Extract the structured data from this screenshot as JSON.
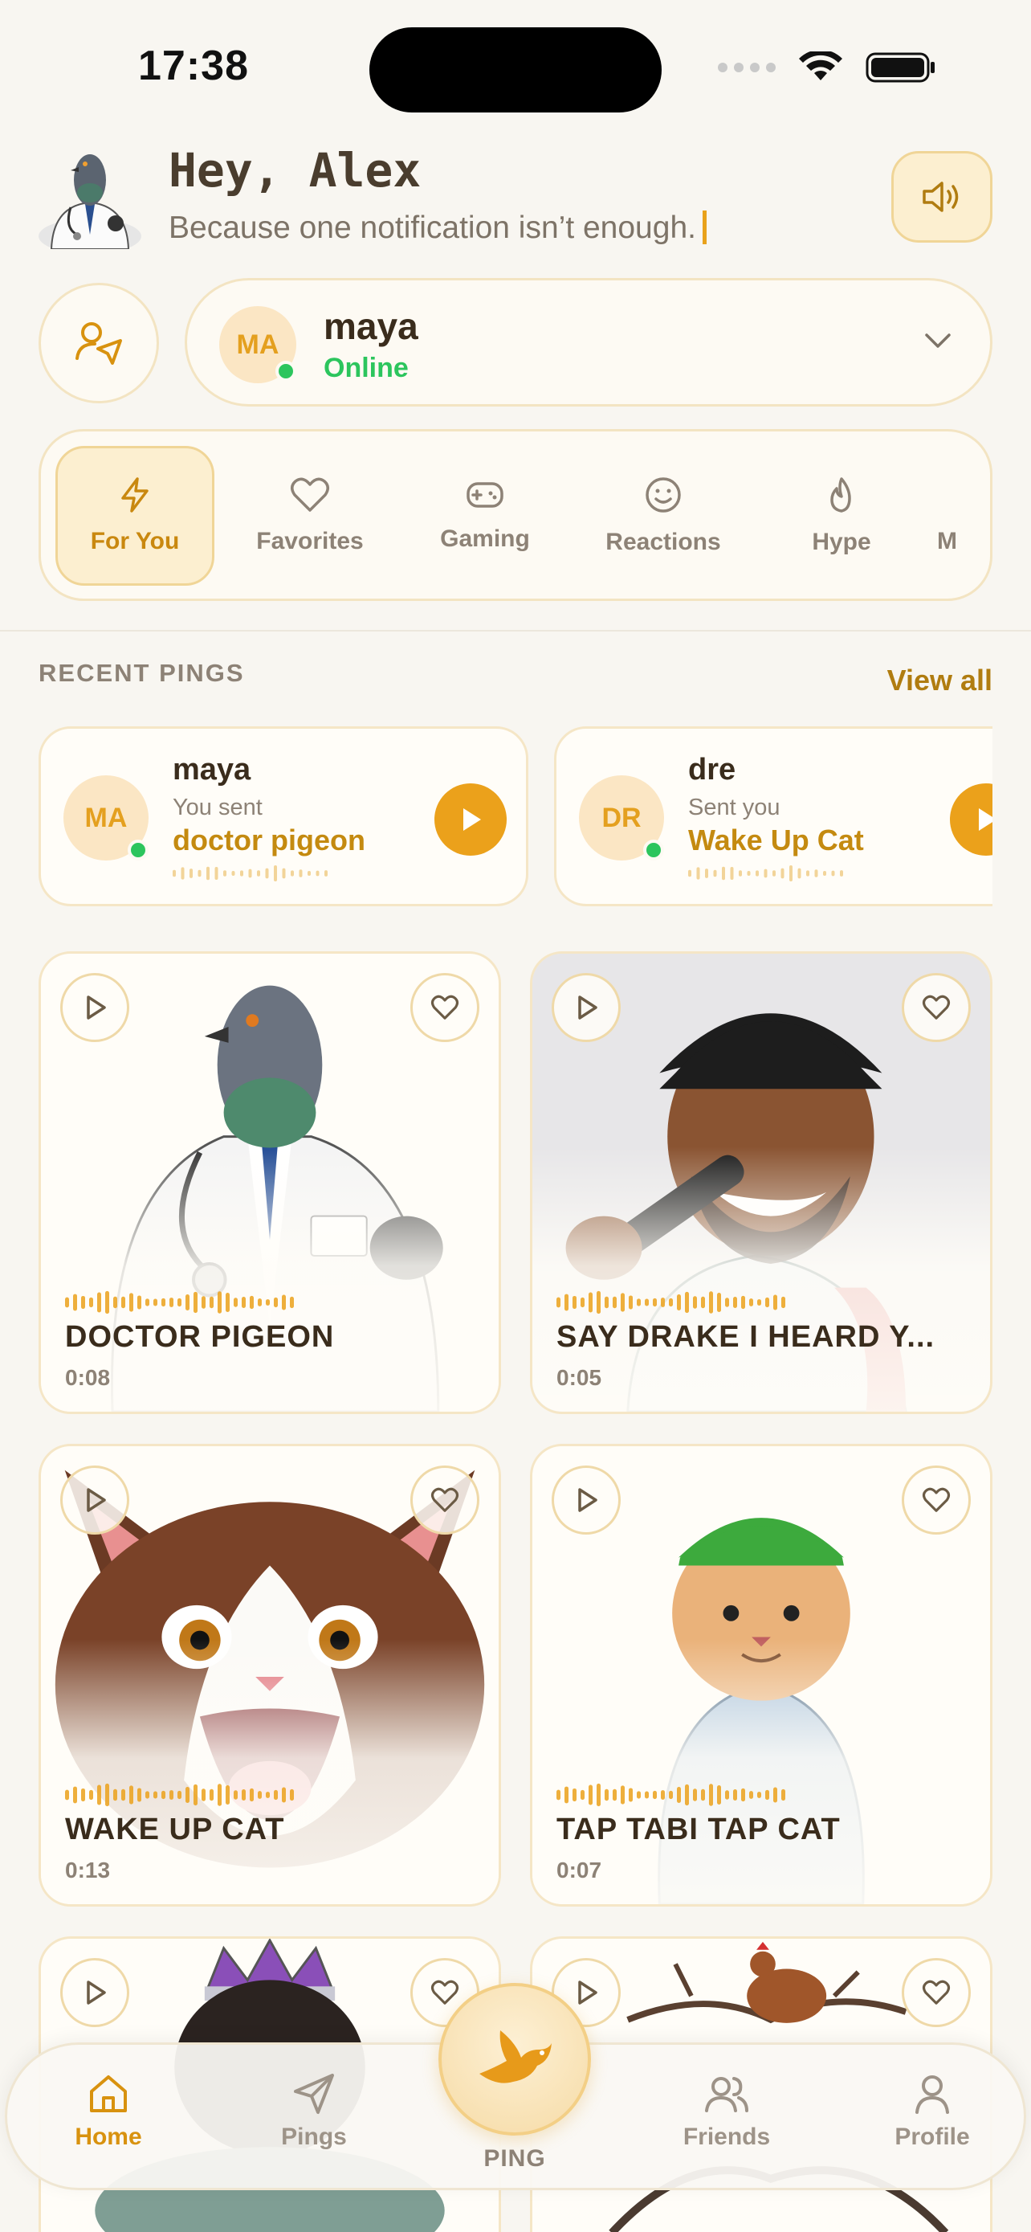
{
  "status_bar": {
    "time": "17:38"
  },
  "header": {
    "greeting": "Hey, Alex",
    "tagline": "Because one notification isn’t enough."
  },
  "recipient": {
    "initials": "MA",
    "name": "maya",
    "status": "Online"
  },
  "categories": [
    {
      "label": "For You",
      "icon": "lightning-icon",
      "active": true
    },
    {
      "label": "Favorites",
      "icon": "heart-icon"
    },
    {
      "label": "Gaming",
      "icon": "gamepad-icon"
    },
    {
      "label": "Reactions",
      "icon": "smiley-icon"
    },
    {
      "label": "Hype",
      "icon": "flame-icon"
    },
    {
      "label": "M",
      "icon": ""
    }
  ],
  "recent": {
    "title": "RECENT PINGS",
    "view_all": "View all",
    "items": [
      {
        "initials": "MA",
        "name": "maya",
        "action": "You sent",
        "sound": "doctor pigeon",
        "online": true
      },
      {
        "initials": "DR",
        "name": "dre",
        "action": "Sent you",
        "sound": "Wake Up Cat",
        "online": true
      }
    ]
  },
  "sounds": [
    {
      "title": "DOCTOR PIGEON",
      "duration": "0:08"
    },
    {
      "title": "SAY DRAKE I HEARD Y...",
      "duration": "0:05"
    },
    {
      "title": "WAKE UP CAT",
      "duration": "0:13"
    },
    {
      "title": "TAP TABI TAP CAT",
      "duration": "0:07"
    },
    {
      "title": "",
      "duration": ""
    },
    {
      "title": "",
      "duration": ""
    }
  ],
  "nav": {
    "home": "Home",
    "pings": "Pings",
    "ping": "PING",
    "friends": "Friends",
    "profile": "Profile"
  },
  "colors": {
    "accent": "#EBA11B",
    "online": "#2CC55D",
    "background": "#F8F6F1",
    "card_border": "#F5E6C6"
  }
}
